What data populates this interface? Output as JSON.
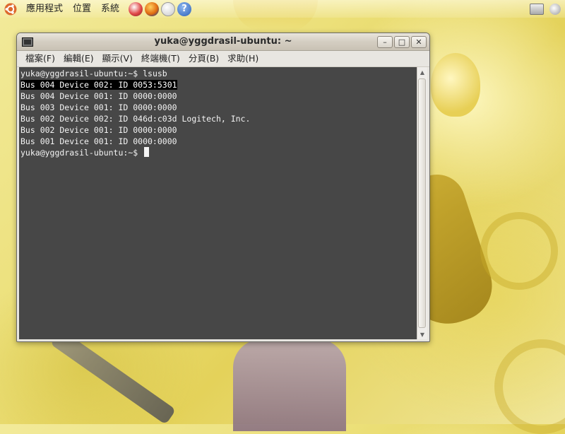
{
  "panel": {
    "menus": [
      "應用程式",
      "位置",
      "系統"
    ],
    "launchers": [
      "evolution-icon",
      "firefox-icon",
      "mail-icon",
      "help-icon"
    ],
    "help_glyph": "?"
  },
  "window": {
    "title": "yuka@yggdrasil-ubuntu: ~",
    "buttons": {
      "minimize": "–",
      "maximize": "□",
      "close": "✕"
    },
    "menu": [
      "檔案(F)",
      "編輯(E)",
      "顯示(V)",
      "終端機(T)",
      "分頁(B)",
      "求助(H)"
    ]
  },
  "terminal": {
    "prompt": "yuka@yggdrasil-ubuntu:~$ ",
    "command": "lsusb",
    "lines": [
      "Bus 004 Device 002: ID 0053:5301",
      "Bus 004 Device 001: ID 0000:0000",
      "Bus 003 Device 001: ID 0000:0000",
      "Bus 002 Device 002: ID 046d:c03d Logitech, Inc.",
      "Bus 002 Device 001: ID 0000:0000",
      "Bus 001 Device 001: ID 0000:0000"
    ],
    "highlighted_line_index": 0
  },
  "colors": {
    "terminal_bg": "#474747",
    "terminal_fg": "#f4f4f4",
    "selection_bg": "#000000"
  }
}
